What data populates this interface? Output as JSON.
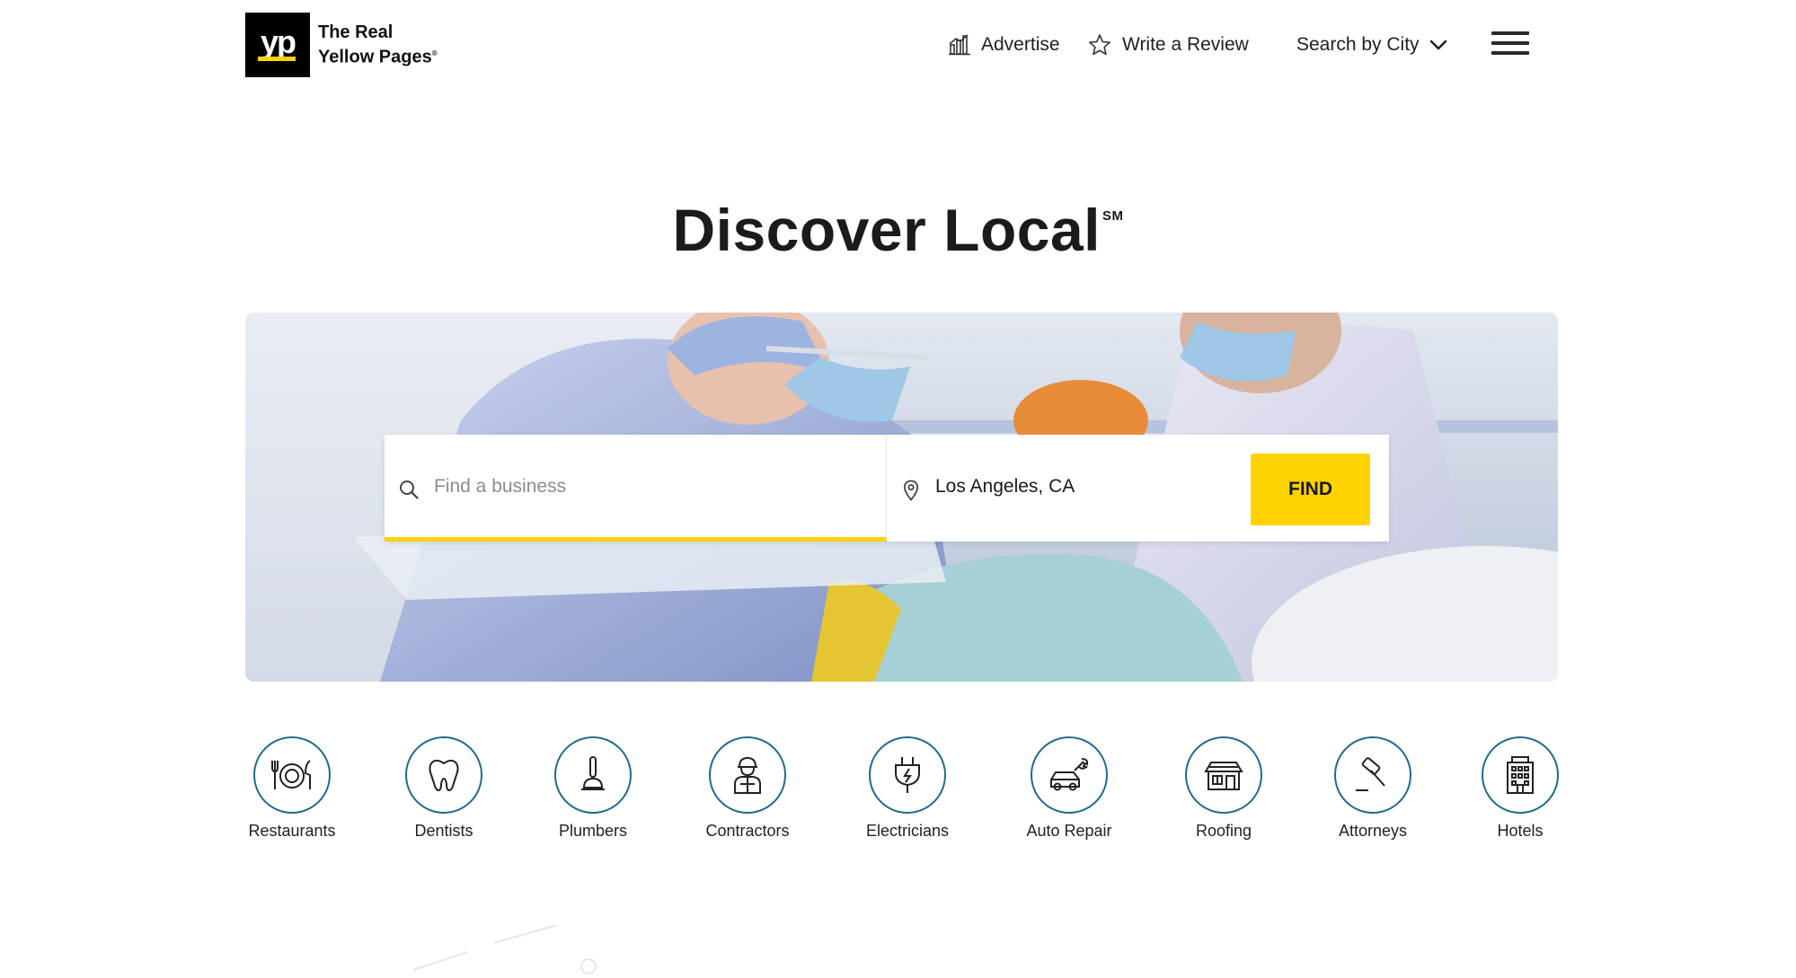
{
  "header": {
    "logo_mark": "yp",
    "logo_line1": "The Real",
    "logo_line2": "Yellow Pages",
    "nav": {
      "advertise": "Advertise",
      "advertise_icon": "chart-icon",
      "review": "Write a Review",
      "review_icon": "star-icon",
      "city": "Search by City",
      "city_icon": "chevron-down-icon",
      "menu_icon": "hamburger-menu-icon"
    }
  },
  "hero": {
    "title": "Discover Local",
    "title_mark": "SM"
  },
  "search": {
    "what_placeholder": "Find a business",
    "what_value": "",
    "where_value": "Los Angeles, CA",
    "find_label": "FIND",
    "search_icon": "search-icon",
    "location_icon": "map-pin-icon"
  },
  "categories": [
    {
      "label": "Restaurants",
      "icon": "plate-fork-knife-icon"
    },
    {
      "label": "Dentists",
      "icon": "tooth-icon"
    },
    {
      "label": "Plumbers",
      "icon": "plunger-icon"
    },
    {
      "label": "Contractors",
      "icon": "worker-icon"
    },
    {
      "label": "Electricians",
      "icon": "plug-icon"
    },
    {
      "label": "Auto Repair",
      "icon": "car-wrench-icon"
    },
    {
      "label": "Roofing",
      "icon": "house-roof-icon"
    },
    {
      "label": "Attorneys",
      "icon": "gavel-icon"
    },
    {
      "label": "Hotels",
      "icon": "hotel-building-icon"
    }
  ],
  "colors": {
    "brand_yellow": "#ffd200",
    "icon_circle": "#1f6b8e",
    "text": "#1a1a1a"
  }
}
